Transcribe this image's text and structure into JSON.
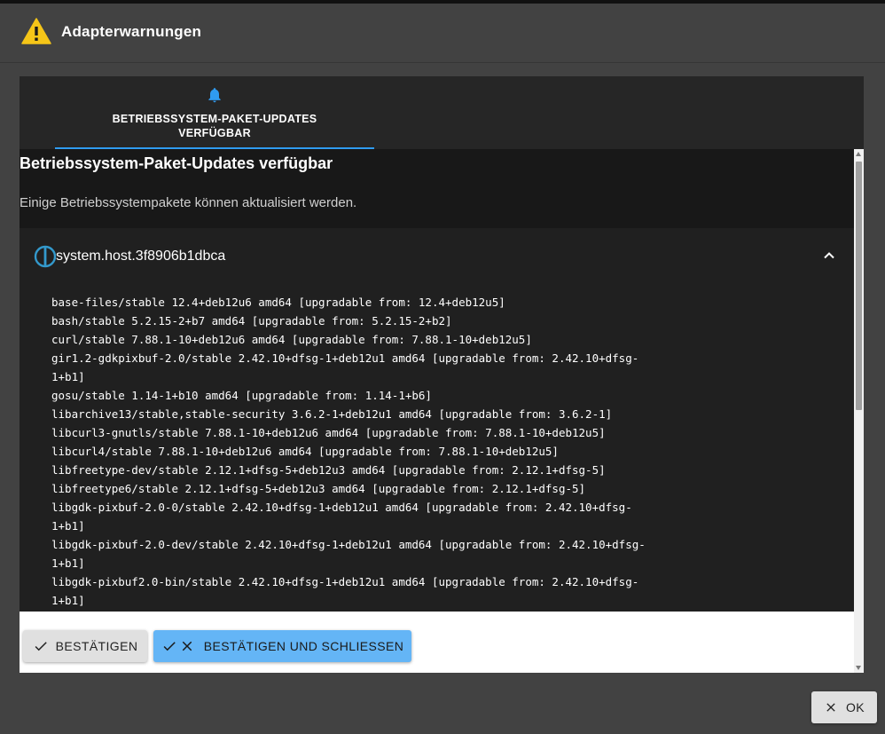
{
  "dialog": {
    "title": "Adapterwarnungen",
    "icon": "warning-icon",
    "ok_label": "OK"
  },
  "tab": {
    "label": "BETRIEBSSYSTEM-PAKET-UPDATES VERFÜGBAR",
    "icon": "bell-icon",
    "accent_color": "#2f9bf0"
  },
  "message": {
    "title": "Betriebssystem-Paket-Updates verfügbar",
    "description": "Einige Betriebssystempakete können aktualisiert werden."
  },
  "host": {
    "name": "system.host.3f8906b1dbca",
    "icon": "iobroker-logo-icon"
  },
  "packages": [
    "base-files/stable 12.4+deb12u6 amd64 [upgradable from: 12.4+deb12u5]",
    "bash/stable 5.2.15-2+b7 amd64 [upgradable from: 5.2.15-2+b2]",
    "curl/stable 7.88.1-10+deb12u6 amd64 [upgradable from: 7.88.1-10+deb12u5]",
    "gir1.2-gdkpixbuf-2.0/stable 2.42.10+dfsg-1+deb12u1 amd64 [upgradable from: 2.42.10+dfsg-\n1+b1]",
    "gosu/stable 1.14-1+b10 amd64 [upgradable from: 1.14-1+b6]",
    "libarchive13/stable,stable-security 3.6.2-1+deb12u1 amd64 [upgradable from: 3.6.2-1]",
    "libcurl3-gnutls/stable 7.88.1-10+deb12u6 amd64 [upgradable from: 7.88.1-10+deb12u5]",
    "libcurl4/stable 7.88.1-10+deb12u6 amd64 [upgradable from: 7.88.1-10+deb12u5]",
    "libfreetype-dev/stable 2.12.1+dfsg-5+deb12u3 amd64 [upgradable from: 2.12.1+dfsg-5]",
    "libfreetype6/stable 2.12.1+dfsg-5+deb12u3 amd64 [upgradable from: 2.12.1+dfsg-5]",
    "libgdk-pixbuf-2.0-0/stable 2.42.10+dfsg-1+deb12u1 amd64 [upgradable from: 2.42.10+dfsg-\n1+b1]",
    "libgdk-pixbuf-2.0-dev/stable 2.42.10+dfsg-1+deb12u1 amd64 [upgradable from: 2.42.10+dfsg-\n1+b1]",
    "libgdk-pixbuf2.0-bin/stable 2.42.10+dfsg-1+deb12u1 amd64 [upgradable from: 2.42.10+dfsg-\n1+b1]"
  ],
  "actions": {
    "confirm_label": "BESTÄTIGEN",
    "confirm_close_label": "BESTÄTIGEN UND SCHLIESSEN",
    "primary_color": "#64b5f6"
  }
}
